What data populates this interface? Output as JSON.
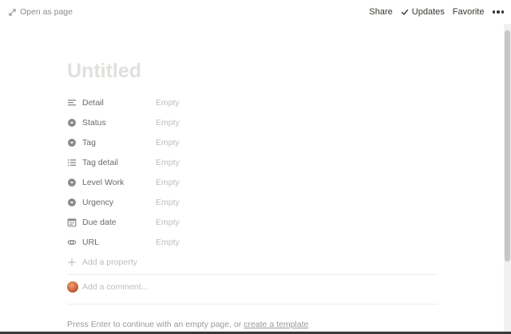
{
  "topbar": {
    "open_as_page": "Open as page",
    "share": "Share",
    "updates": "Updates",
    "favorite": "Favorite"
  },
  "page": {
    "title_placeholder": "Untitled"
  },
  "properties": [
    {
      "name": "Detail",
      "value": "Empty",
      "icon": "text-lines-icon"
    },
    {
      "name": "Status",
      "value": "Empty",
      "icon": "select-icon"
    },
    {
      "name": "Tag",
      "value": "Empty",
      "icon": "select-icon"
    },
    {
      "name": "Tag detail",
      "value": "Empty",
      "icon": "multi-select-icon"
    },
    {
      "name": "Level Work",
      "value": "Empty",
      "icon": "select-icon"
    },
    {
      "name": "Urgency",
      "value": "Empty",
      "icon": "select-icon"
    },
    {
      "name": "Due date",
      "value": "Empty",
      "icon": "calendar-icon"
    },
    {
      "name": "URL",
      "value": "Empty",
      "icon": "link-icon"
    }
  ],
  "add_property": "Add a property",
  "comment": {
    "placeholder": "Add a comment..."
  },
  "footer": {
    "text": "Press Enter to continue with an empty page, or",
    "link": "create a template"
  },
  "colors": {
    "text": "#37352f",
    "muted": "#8c8b87",
    "placeholder": "#bebdb9",
    "title_placeholder": "#e1e0dd",
    "divider": "#ededeb"
  }
}
